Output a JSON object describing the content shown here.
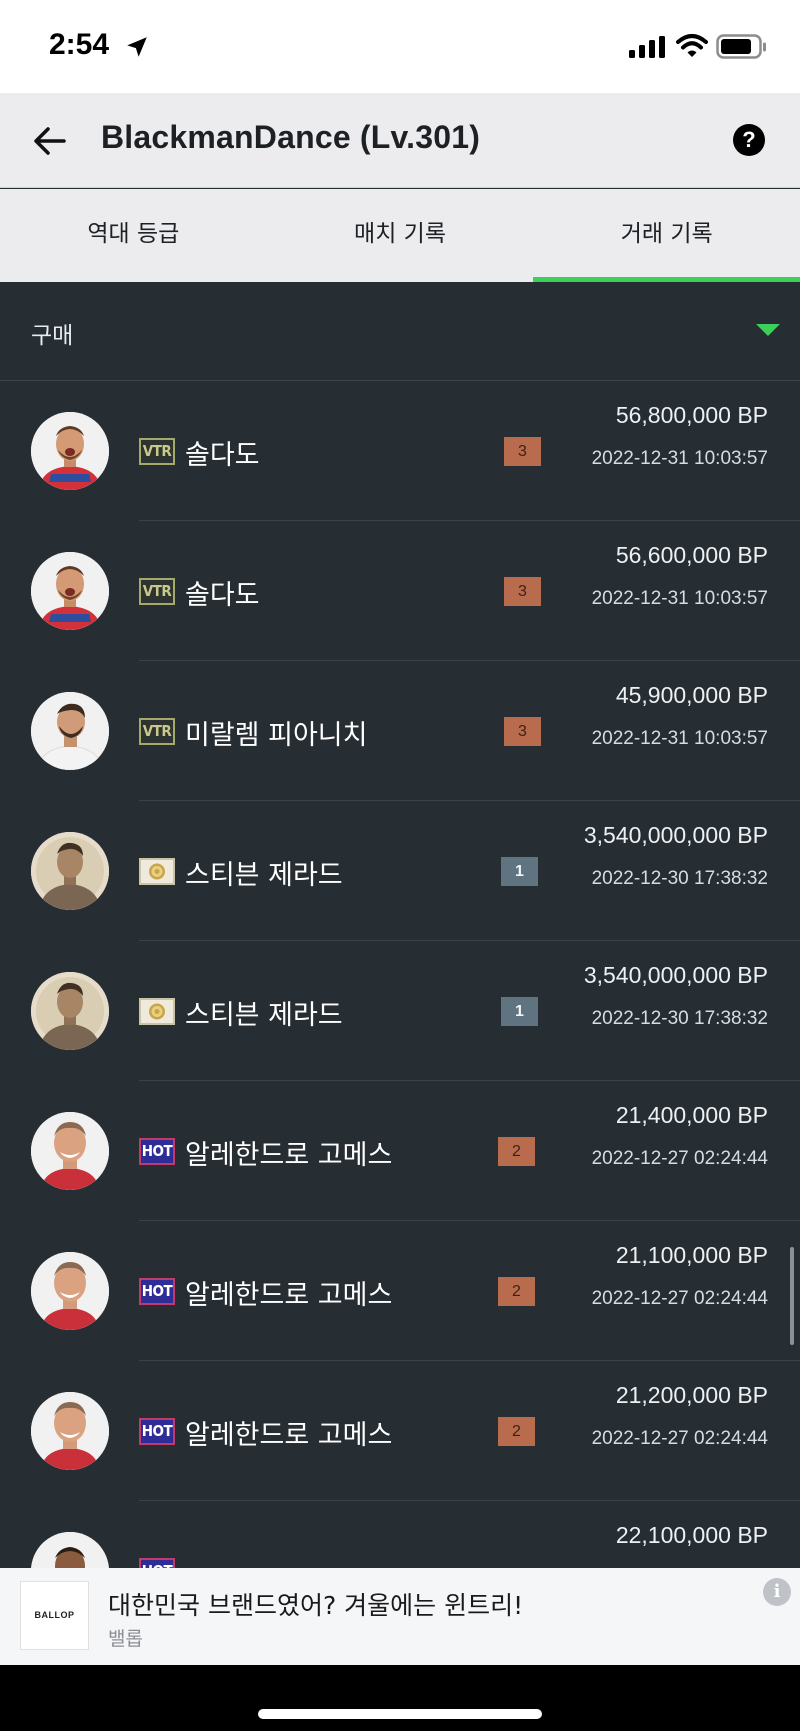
{
  "status_bar": {
    "time": "2:54",
    "icons": [
      "location-arrow-icon",
      "cellular-signal-icon",
      "wifi-icon",
      "battery-icon"
    ]
  },
  "header": {
    "title": "BlackmanDance (Lv.301)",
    "help_label": "?"
  },
  "tabs": [
    {
      "label": "역대 등급",
      "active": false
    },
    {
      "label": "매치 기록",
      "active": false
    },
    {
      "label": "거래 기록",
      "active": true
    }
  ],
  "filter": {
    "selected": "구매"
  },
  "colors": {
    "accent": "#3ccf5a",
    "background": "#262d33",
    "grade_bronze": "#b86b4d",
    "grade_silver": "#5f7480"
  },
  "transactions": [
    {
      "season": "VTR",
      "name": "솔다도",
      "grade": "3",
      "price": "56,800,000 BP",
      "date": "2022-12-31 10:03:57",
      "avatar": "soldado"
    },
    {
      "season": "VTR",
      "name": "솔다도",
      "grade": "3",
      "price": "56,600,000 BP",
      "date": "2022-12-31 10:03:57",
      "avatar": "soldado"
    },
    {
      "season": "VTR",
      "name": "미랄렘 피아니치",
      "grade": "3",
      "price": "45,900,000 BP",
      "date": "2022-12-31 10:03:57",
      "avatar": "pjanic"
    },
    {
      "season": "ICON",
      "name": "스티븐 제라드",
      "grade": "1",
      "price": "3,540,000,000 BP",
      "date": "2022-12-30 17:38:32",
      "avatar": "gerrard"
    },
    {
      "season": "ICON",
      "name": "스티븐 제라드",
      "grade": "1",
      "price": "3,540,000,000 BP",
      "date": "2022-12-30 17:38:32",
      "avatar": "gerrard"
    },
    {
      "season": "HOT",
      "name": "알레한드로 고메스",
      "grade": "2",
      "price": "21,400,000 BP",
      "date": "2022-12-27 02:24:44",
      "avatar": "gomez"
    },
    {
      "season": "HOT",
      "name": "알레한드로 고메스",
      "grade": "2",
      "price": "21,100,000 BP",
      "date": "2022-12-27 02:24:44",
      "avatar": "gomez"
    },
    {
      "season": "HOT",
      "name": "알레한드로 고메스",
      "grade": "2",
      "price": "21,200,000 BP",
      "date": "2022-12-27 02:24:44",
      "avatar": "gomez"
    },
    {
      "season": "HOT",
      "name": "",
      "grade": "",
      "price": "22,100,000 BP",
      "date": "",
      "avatar": "partial"
    }
  ],
  "ad": {
    "logo_text": "BALLOP",
    "headline": "대한민국 브랜드였어? 겨울에는 윈트리!",
    "brand": "밸롭",
    "info_label": "i"
  }
}
